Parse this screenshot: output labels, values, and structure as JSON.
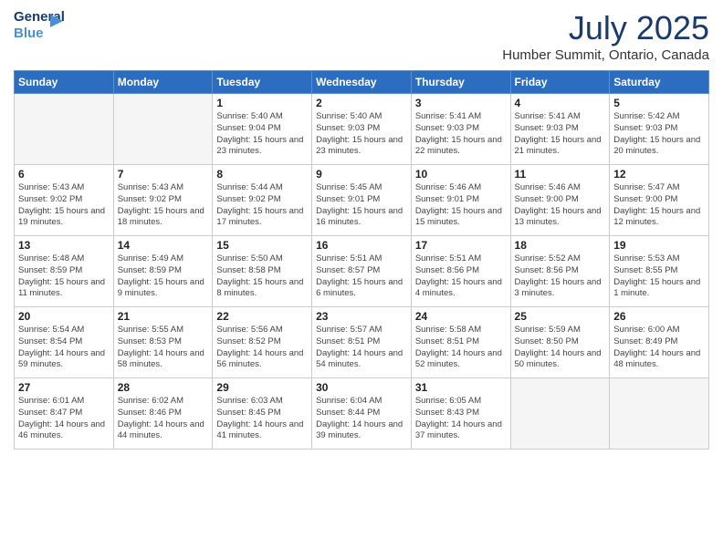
{
  "logo": {
    "line1": "General",
    "line2": "Blue"
  },
  "title": "July 2025",
  "subtitle": "Humber Summit, Ontario, Canada",
  "days_of_week": [
    "Sunday",
    "Monday",
    "Tuesday",
    "Wednesday",
    "Thursday",
    "Friday",
    "Saturday"
  ],
  "weeks": [
    [
      {
        "day": "",
        "info": ""
      },
      {
        "day": "",
        "info": ""
      },
      {
        "day": "1",
        "info": "Sunrise: 5:40 AM\nSunset: 9:04 PM\nDaylight: 15 hours\nand 23 minutes."
      },
      {
        "day": "2",
        "info": "Sunrise: 5:40 AM\nSunset: 9:03 PM\nDaylight: 15 hours\nand 23 minutes."
      },
      {
        "day": "3",
        "info": "Sunrise: 5:41 AM\nSunset: 9:03 PM\nDaylight: 15 hours\nand 22 minutes."
      },
      {
        "day": "4",
        "info": "Sunrise: 5:41 AM\nSunset: 9:03 PM\nDaylight: 15 hours\nand 21 minutes."
      },
      {
        "day": "5",
        "info": "Sunrise: 5:42 AM\nSunset: 9:03 PM\nDaylight: 15 hours\nand 20 minutes."
      }
    ],
    [
      {
        "day": "6",
        "info": "Sunrise: 5:43 AM\nSunset: 9:02 PM\nDaylight: 15 hours\nand 19 minutes."
      },
      {
        "day": "7",
        "info": "Sunrise: 5:43 AM\nSunset: 9:02 PM\nDaylight: 15 hours\nand 18 minutes."
      },
      {
        "day": "8",
        "info": "Sunrise: 5:44 AM\nSunset: 9:02 PM\nDaylight: 15 hours\nand 17 minutes."
      },
      {
        "day": "9",
        "info": "Sunrise: 5:45 AM\nSunset: 9:01 PM\nDaylight: 15 hours\nand 16 minutes."
      },
      {
        "day": "10",
        "info": "Sunrise: 5:46 AM\nSunset: 9:01 PM\nDaylight: 15 hours\nand 15 minutes."
      },
      {
        "day": "11",
        "info": "Sunrise: 5:46 AM\nSunset: 9:00 PM\nDaylight: 15 hours\nand 13 minutes."
      },
      {
        "day": "12",
        "info": "Sunrise: 5:47 AM\nSunset: 9:00 PM\nDaylight: 15 hours\nand 12 minutes."
      }
    ],
    [
      {
        "day": "13",
        "info": "Sunrise: 5:48 AM\nSunset: 8:59 PM\nDaylight: 15 hours\nand 11 minutes."
      },
      {
        "day": "14",
        "info": "Sunrise: 5:49 AM\nSunset: 8:59 PM\nDaylight: 15 hours\nand 9 minutes."
      },
      {
        "day": "15",
        "info": "Sunrise: 5:50 AM\nSunset: 8:58 PM\nDaylight: 15 hours\nand 8 minutes."
      },
      {
        "day": "16",
        "info": "Sunrise: 5:51 AM\nSunset: 8:57 PM\nDaylight: 15 hours\nand 6 minutes."
      },
      {
        "day": "17",
        "info": "Sunrise: 5:51 AM\nSunset: 8:56 PM\nDaylight: 15 hours\nand 4 minutes."
      },
      {
        "day": "18",
        "info": "Sunrise: 5:52 AM\nSunset: 8:56 PM\nDaylight: 15 hours\nand 3 minutes."
      },
      {
        "day": "19",
        "info": "Sunrise: 5:53 AM\nSunset: 8:55 PM\nDaylight: 15 hours\nand 1 minute."
      }
    ],
    [
      {
        "day": "20",
        "info": "Sunrise: 5:54 AM\nSunset: 8:54 PM\nDaylight: 14 hours\nand 59 minutes."
      },
      {
        "day": "21",
        "info": "Sunrise: 5:55 AM\nSunset: 8:53 PM\nDaylight: 14 hours\nand 58 minutes."
      },
      {
        "day": "22",
        "info": "Sunrise: 5:56 AM\nSunset: 8:52 PM\nDaylight: 14 hours\nand 56 minutes."
      },
      {
        "day": "23",
        "info": "Sunrise: 5:57 AM\nSunset: 8:51 PM\nDaylight: 14 hours\nand 54 minutes."
      },
      {
        "day": "24",
        "info": "Sunrise: 5:58 AM\nSunset: 8:51 PM\nDaylight: 14 hours\nand 52 minutes."
      },
      {
        "day": "25",
        "info": "Sunrise: 5:59 AM\nSunset: 8:50 PM\nDaylight: 14 hours\nand 50 minutes."
      },
      {
        "day": "26",
        "info": "Sunrise: 6:00 AM\nSunset: 8:49 PM\nDaylight: 14 hours\nand 48 minutes."
      }
    ],
    [
      {
        "day": "27",
        "info": "Sunrise: 6:01 AM\nSunset: 8:47 PM\nDaylight: 14 hours\nand 46 minutes."
      },
      {
        "day": "28",
        "info": "Sunrise: 6:02 AM\nSunset: 8:46 PM\nDaylight: 14 hours\nand 44 minutes."
      },
      {
        "day": "29",
        "info": "Sunrise: 6:03 AM\nSunset: 8:45 PM\nDaylight: 14 hours\nand 41 minutes."
      },
      {
        "day": "30",
        "info": "Sunrise: 6:04 AM\nSunset: 8:44 PM\nDaylight: 14 hours\nand 39 minutes."
      },
      {
        "day": "31",
        "info": "Sunrise: 6:05 AM\nSunset: 8:43 PM\nDaylight: 14 hours\nand 37 minutes."
      },
      {
        "day": "",
        "info": ""
      },
      {
        "day": "",
        "info": ""
      }
    ]
  ]
}
